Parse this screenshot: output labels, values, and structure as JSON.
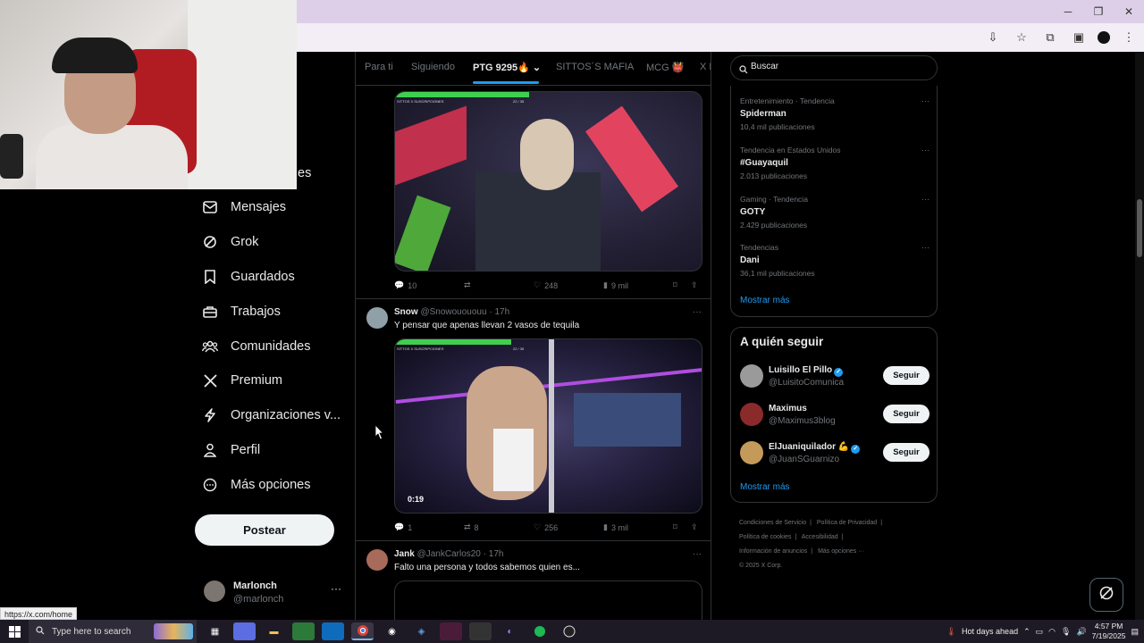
{
  "browser": {
    "window_controls": [
      "─",
      "❐",
      "✕"
    ],
    "status_url": "https://x.com/home"
  },
  "sidebar": {
    "partial_item_suffix": "es",
    "items": [
      {
        "label": "Mensajes",
        "icon": "mail-icon"
      },
      {
        "label": "Grok",
        "icon": "grok-icon"
      },
      {
        "label": "Guardados",
        "icon": "bookmark-icon"
      },
      {
        "label": "Trabajos",
        "icon": "briefcase-icon"
      },
      {
        "label": "Comunidades",
        "icon": "communities-icon"
      },
      {
        "label": "Premium",
        "icon": "x-logo-icon"
      },
      {
        "label": "Organizaciones v...",
        "icon": "lightning-icon"
      },
      {
        "label": "Perfil",
        "icon": "person-icon"
      },
      {
        "label": "Más opciones",
        "icon": "more-circle-icon"
      }
    ],
    "post_button": "Postear",
    "account": {
      "name": "Marlonch",
      "handle": "@marlonch",
      "more": "···"
    }
  },
  "feed": {
    "tabs": [
      "Para ti",
      "Siguiendo",
      "PTG 9295🔥",
      "SITTOS´S MAFIA",
      "MCG 👹",
      "X R"
    ],
    "active_tab": 2,
    "tweets": [
      {
        "hud_label": "SITTOS X SUSCRIPCIONES",
        "hud_count": "22 / 35",
        "actions": {
          "replies": "10",
          "retweets": "",
          "likes": "248",
          "views": "9 mil"
        }
      },
      {
        "name": "Snow",
        "handle": "@Snowouououu",
        "time": "· 17h",
        "text": "Y pensar que apenas llevan 2 vasos de tequila",
        "hud_label": "SITTOS X SUSCRIPCIONES",
        "hud_count": "22 / 35",
        "video_time": "0:19",
        "actions": {
          "replies": "1",
          "retweets": "8",
          "likes": "256",
          "views": "3 mil"
        }
      },
      {
        "name": "Jank",
        "handle": "@JankCarlos20",
        "time": "· 17h",
        "text": "Falto una persona y todos sabemos quien es..."
      }
    ]
  },
  "search": {
    "placeholder": "Buscar"
  },
  "trends": [
    {
      "context": "Entretenimiento · Tendencia",
      "title": "Spiderman",
      "count": "10,4 mil publicaciones"
    },
    {
      "context": "Tendencia en Estados Unidos",
      "title": "#Guayaquil",
      "count": "2.013 publicaciones"
    },
    {
      "context": "Gaming · Tendencia",
      "title": "GOTY",
      "count": "2.429 publicaciones"
    },
    {
      "context": "Tendencias",
      "title": "Dani",
      "count": "36,1 mil publicaciones"
    }
  ],
  "trends_show_more": "Mostrar más",
  "who_to_follow": {
    "title": "A quién seguir",
    "users": [
      {
        "name": "Luisillo El Pillo",
        "verified": true,
        "handle": "@LuisitoComunica",
        "button": "Seguir"
      },
      {
        "name": "Maximus",
        "verified": false,
        "handle": "@Maximus3blog",
        "button": "Seguir"
      },
      {
        "name": "ElJuaniquilador 💪",
        "verified": true,
        "handle": "@JuanSGuarnizo",
        "button": "Seguir"
      }
    ],
    "show_more": "Mostrar más"
  },
  "footer": {
    "links": [
      "Condiciones de Servicio",
      "|",
      "Política de Privacidad",
      "|",
      "Política de cookies",
      "|",
      "Accesibilidad",
      "|",
      "Información de anuncios",
      "|",
      "Más opciones ···"
    ],
    "copyright": "© 2025 X Corp."
  },
  "taskbar": {
    "search_placeholder": "Type here to search",
    "weather": "Hot days ahead",
    "time": "4:57 PM",
    "date": "7/19/2025"
  },
  "colors": {
    "accent": "#1d9bf0",
    "background": "#000000",
    "border": "#2f3336",
    "muted": "#71767b"
  }
}
